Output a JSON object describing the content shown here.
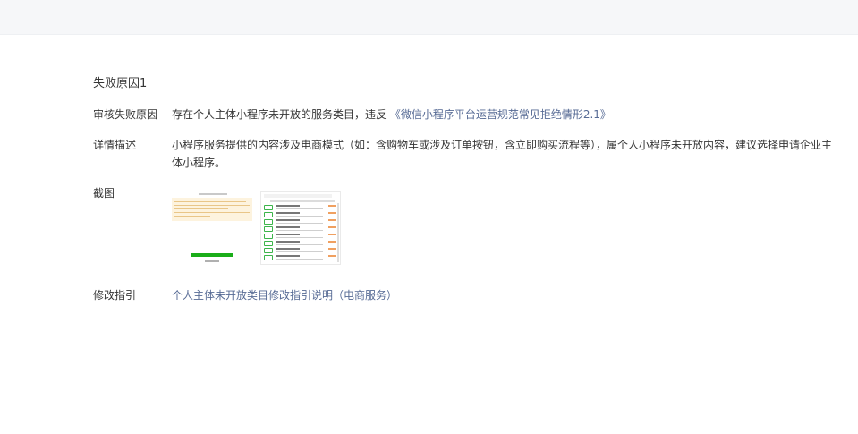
{
  "section": {
    "title": "失败原因1"
  },
  "review_reason": {
    "label": "审核失败原因",
    "text": "存在个人主体小程序未开放的服务类目，违反 ",
    "link": "《微信小程序平台运营规范常见拒绝情形2.1》"
  },
  "detail": {
    "label": "详情描述",
    "text": "小程序服务提供的内容涉及电商模式（如：含购物车或涉及订单按钮，含立即购买流程等），属个人小程序未开放内容，建议选择申请企业主体小程序。"
  },
  "screenshot": {
    "label": "截图",
    "items": [
      "screenshot-thumb-1",
      "screenshot-thumb-2"
    ]
  },
  "guide": {
    "label": "修改指引",
    "link": "个人主体未开放类目修改指引说明（电商服务）"
  },
  "colors": {
    "link": "#576b95",
    "text": "#353535",
    "topbar": "#f6f7f9",
    "green": "#1aad19"
  }
}
